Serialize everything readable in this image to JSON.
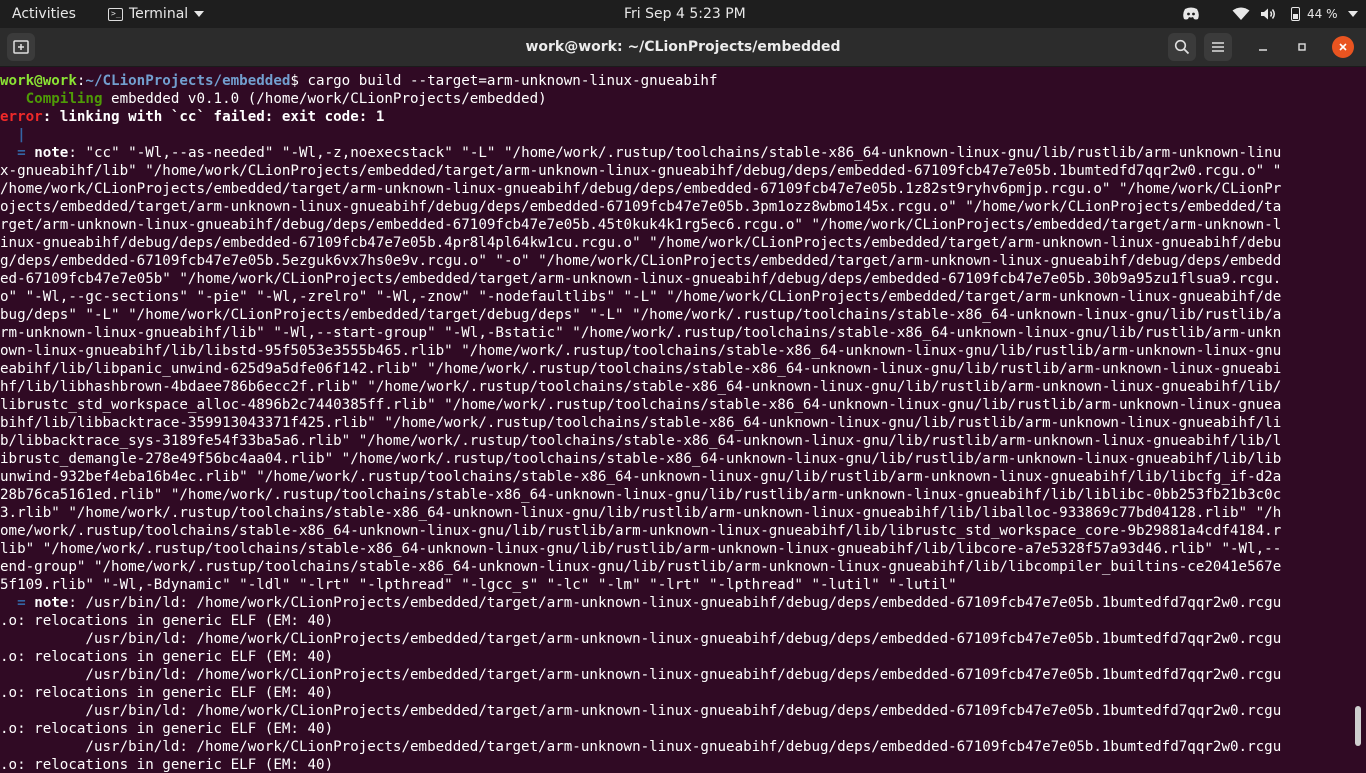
{
  "topbar": {
    "activities": "Activities",
    "app_name": "Terminal",
    "clock": "Fri Sep 4   5:23 PM",
    "battery": "44 %"
  },
  "window": {
    "title": "work@work: ~/CLionProjects/embedded"
  },
  "terminal": {
    "prompt_user": "work@work",
    "prompt_sep": ":",
    "prompt_path": "~/CLionProjects/embedded",
    "prompt_dollar": "$",
    "command": " cargo build --target=arm-unknown-linux-gnueabihf",
    "compiling_word": "Compiling",
    "compiling_rest": " embedded v0.1.0 (/home/work/CLionProjects/embedded)",
    "error_word": "error",
    "error_msg": ": linking with `cc` failed: exit code: 1",
    "pipe": "|",
    "note_eq": "=",
    "note_word": "note",
    "note1_lines": [
      ": \"cc\" \"-Wl,--as-needed\" \"-Wl,-z,noexecstack\" \"-L\" \"/home/work/.rustup/toolchains/stable-x86_64-unknown-linux-gnu/lib/rustlib/arm-unknown-linu",
      "x-gnueabihf/lib\" \"/home/work/CLionProjects/embedded/target/arm-unknown-linux-gnueabihf/debug/deps/embedded-67109fcb47e7e05b.1bumtedfd7qqr2w0.rcgu.o\" \"",
      "/home/work/CLionProjects/embedded/target/arm-unknown-linux-gnueabihf/debug/deps/embedded-67109fcb47e7e05b.1z82st9ryhv6pmjp.rcgu.o\" \"/home/work/CLionPr",
      "ojects/embedded/target/arm-unknown-linux-gnueabihf/debug/deps/embedded-67109fcb47e7e05b.3pm1ozz8wbmo145x.rcgu.o\" \"/home/work/CLionProjects/embedded/ta",
      "rget/arm-unknown-linux-gnueabihf/debug/deps/embedded-67109fcb47e7e05b.45t0kuk4k1rg5ec6.rcgu.o\" \"/home/work/CLionProjects/embedded/target/arm-unknown-l",
      "inux-gnueabihf/debug/deps/embedded-67109fcb47e7e05b.4pr8l4pl64kw1cu.rcgu.o\" \"/home/work/CLionProjects/embedded/target/arm-unknown-linux-gnueabihf/debu",
      "g/deps/embedded-67109fcb47e7e05b.5ezguk6vx7hs0e9v.rcgu.o\" \"-o\" \"/home/work/CLionProjects/embedded/target/arm-unknown-linux-gnueabihf/debug/deps/embedd",
      "ed-67109fcb47e7e05b\" \"/home/work/CLionProjects/embedded/target/arm-unknown-linux-gnueabihf/debug/deps/embedded-67109fcb47e7e05b.30b9a95zu1flsua9.rcgu.",
      "o\" \"-Wl,--gc-sections\" \"-pie\" \"-Wl,-zrelro\" \"-Wl,-znow\" \"-nodefaultlibs\" \"-L\" \"/home/work/CLionProjects/embedded/target/arm-unknown-linux-gnueabihf/de",
      "bug/deps\" \"-L\" \"/home/work/CLionProjects/embedded/target/debug/deps\" \"-L\" \"/home/work/.rustup/toolchains/stable-x86_64-unknown-linux-gnu/lib/rustlib/a",
      "rm-unknown-linux-gnueabihf/lib\" \"-Wl,--start-group\" \"-Wl,-Bstatic\" \"/home/work/.rustup/toolchains/stable-x86_64-unknown-linux-gnu/lib/rustlib/arm-unkn",
      "own-linux-gnueabihf/lib/libstd-95f5053e3555b465.rlib\" \"/home/work/.rustup/toolchains/stable-x86_64-unknown-linux-gnu/lib/rustlib/arm-unknown-linux-gnu",
      "eabihf/lib/libpanic_unwind-625d9a5dfe06f142.rlib\" \"/home/work/.rustup/toolchains/stable-x86_64-unknown-linux-gnu/lib/rustlib/arm-unknown-linux-gnueabi",
      "hf/lib/libhashbrown-4bdaee786b6ecc2f.rlib\" \"/home/work/.rustup/toolchains/stable-x86_64-unknown-linux-gnu/lib/rustlib/arm-unknown-linux-gnueabihf/lib/",
      "librustc_std_workspace_alloc-4896b2c7440385ff.rlib\" \"/home/work/.rustup/toolchains/stable-x86_64-unknown-linux-gnu/lib/rustlib/arm-unknown-linux-gnuea",
      "bihf/lib/libbacktrace-359913043371f425.rlib\" \"/home/work/.rustup/toolchains/stable-x86_64-unknown-linux-gnu/lib/rustlib/arm-unknown-linux-gnueabihf/li",
      "b/libbacktrace_sys-3189fe54f33ba5a6.rlib\" \"/home/work/.rustup/toolchains/stable-x86_64-unknown-linux-gnu/lib/rustlib/arm-unknown-linux-gnueabihf/lib/l",
      "ibrustc_demangle-278e49f56bc4aa04.rlib\" \"/home/work/.rustup/toolchains/stable-x86_64-unknown-linux-gnu/lib/rustlib/arm-unknown-linux-gnueabihf/lib/lib",
      "unwind-932bef4eba16b4ec.rlib\" \"/home/work/.rustup/toolchains/stable-x86_64-unknown-linux-gnu/lib/rustlib/arm-unknown-linux-gnueabihf/lib/libcfg_if-d2a",
      "28b76ca5161ed.rlib\" \"/home/work/.rustup/toolchains/stable-x86_64-unknown-linux-gnu/lib/rustlib/arm-unknown-linux-gnueabihf/lib/liblibc-0bb253fb21b3c0c",
      "3.rlib\" \"/home/work/.rustup/toolchains/stable-x86_64-unknown-linux-gnu/lib/rustlib/arm-unknown-linux-gnueabihf/lib/liballoc-933869c77bd04128.rlib\" \"/h",
      "ome/work/.rustup/toolchains/stable-x86_64-unknown-linux-gnu/lib/rustlib/arm-unknown-linux-gnueabihf/lib/librustc_std_workspace_core-9b29881a4cdf4184.r",
      "lib\" \"/home/work/.rustup/toolchains/stable-x86_64-unknown-linux-gnu/lib/rustlib/arm-unknown-linux-gnueabihf/lib/libcore-a7e5328f57a93d46.rlib\" \"-Wl,--",
      "end-group\" \"/home/work/.rustup/toolchains/stable-x86_64-unknown-linux-gnu/lib/rustlib/arm-unknown-linux-gnueabihf/lib/libcompiler_builtins-ce2041e567e",
      "5f109.rlib\" \"-Wl,-Bdynamic\" \"-ldl\" \"-lrt\" \"-lpthread\" \"-lgcc_s\" \"-lc\" \"-lm\" \"-lrt\" \"-lpthread\" \"-lutil\" \"-lutil\""
    ],
    "note2_lines": [
      ": /usr/bin/ld: /home/work/CLionProjects/embedded/target/arm-unknown-linux-gnueabihf/debug/deps/embedded-67109fcb47e7e05b.1bumtedfd7qqr2w0.rcgu",
      ".o: relocations in generic ELF (EM: 40)",
      "          /usr/bin/ld: /home/work/CLionProjects/embedded/target/arm-unknown-linux-gnueabihf/debug/deps/embedded-67109fcb47e7e05b.1bumtedfd7qqr2w0.rcgu",
      ".o: relocations in generic ELF (EM: 40)",
      "          /usr/bin/ld: /home/work/CLionProjects/embedded/target/arm-unknown-linux-gnueabihf/debug/deps/embedded-67109fcb47e7e05b.1bumtedfd7qqr2w0.rcgu",
      ".o: relocations in generic ELF (EM: 40)",
      "          /usr/bin/ld: /home/work/CLionProjects/embedded/target/arm-unknown-linux-gnueabihf/debug/deps/embedded-67109fcb47e7e05b.1bumtedfd7qqr2w0.rcgu",
      ".o: relocations in generic ELF (EM: 40)",
      "          /usr/bin/ld: /home/work/CLionProjects/embedded/target/arm-unknown-linux-gnueabihf/debug/deps/embedded-67109fcb47e7e05b.1bumtedfd7qqr2w0.rcgu",
      ".o: relocations in generic ELF (EM: 40)"
    ]
  },
  "colors": {
    "terminal_bg": "#300a24",
    "prompt_user": "#8ae234",
    "prompt_path": "#729fcf",
    "error": "#ef2929",
    "compiling": "#4e9a06",
    "close_button": "#e95420"
  }
}
